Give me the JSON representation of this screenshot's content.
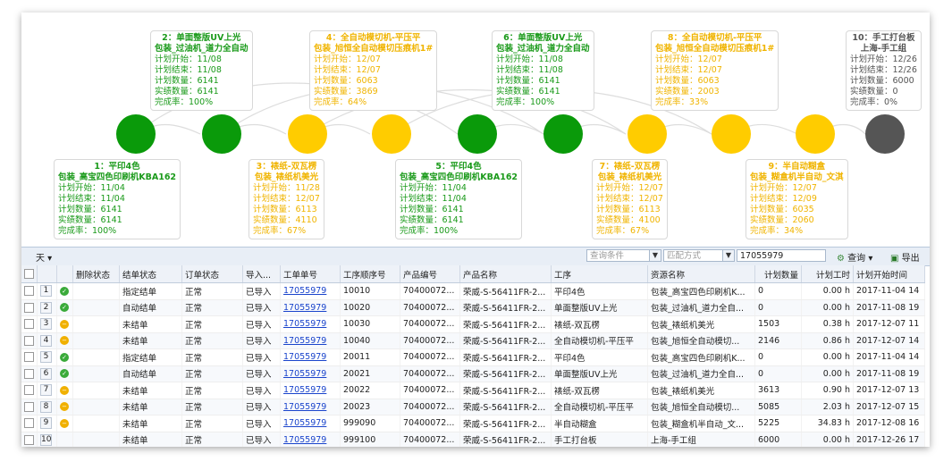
{
  "colors": {
    "green": "#0a9a0a",
    "yellow": "#ffcc00",
    "gray": "#555555"
  },
  "process_nodes": [
    {
      "id": 1,
      "status": "green",
      "title1": "1：平印4色",
      "title2": "包装_高宝四色印刷机KBA162",
      "plan_start": "计划开始：11/04",
      "plan_end": "计划结束：11/04",
      "plan_qty": "计划数量：6141",
      "actual_qty": "实绩数量：6141",
      "completion": "完成率：100%"
    },
    {
      "id": 2,
      "status": "green",
      "title1": "2：单面整版UV上光",
      "title2": "包装_过油机_道力全自动",
      "plan_start": "计划开始：11/08",
      "plan_end": "计划结束：11/08",
      "plan_qty": "计划数量：6141",
      "actual_qty": "实绩数量：6141",
      "completion": "完成率：100%"
    },
    {
      "id": 3,
      "status": "yellow",
      "title1": "3：裱纸-双瓦楞",
      "title2": "包装_裱纸机美光",
      "plan_start": "计划开始：11/28",
      "plan_end": "计划结束：12/07",
      "plan_qty": "计划数量：6113",
      "actual_qty": "实绩数量：4110",
      "completion": "完成率：67%"
    },
    {
      "id": 4,
      "status": "yellow",
      "title1": "4：全自动模切机-平压平",
      "title2": "包装_旭恒全自动模切压痕机1#",
      "plan_start": "计划开始：12/07",
      "plan_end": "计划结束：12/07",
      "plan_qty": "计划数量：6063",
      "actual_qty": "实绩数量：3869",
      "completion": "完成率：64%"
    },
    {
      "id": 5,
      "status": "green",
      "title1": "5：平印4色",
      "title2": "包装_高宝四色印刷机KBA162",
      "plan_start": "计划开始：11/04",
      "plan_end": "计划结束：11/04",
      "plan_qty": "计划数量：6141",
      "actual_qty": "实绩数量：6141",
      "completion": "完成率：100%"
    },
    {
      "id": 6,
      "status": "green",
      "title1": "6：单面整版UV上光",
      "title2": "包装_过油机_道力全自动",
      "plan_start": "计划开始：11/08",
      "plan_end": "计划结束：11/08",
      "plan_qty": "计划数量：6141",
      "actual_qty": "实绩数量：6141",
      "completion": "完成率：100%"
    },
    {
      "id": 7,
      "status": "yellow",
      "title1": "7：裱纸-双瓦楞",
      "title2": "包装_裱纸机美光",
      "plan_start": "计划开始：12/07",
      "plan_end": "计划结束：12/07",
      "plan_qty": "计划数量：6113",
      "actual_qty": "实绩数量：4100",
      "completion": "完成率：67%"
    },
    {
      "id": 8,
      "status": "yellow",
      "title1": "8：全自动模切机-平压平",
      "title2": "包装_旭恒全自动模切压痕机1#",
      "plan_start": "计划开始：12/07",
      "plan_end": "计划结束：12/07",
      "plan_qty": "计划数量：6063",
      "actual_qty": "实绩数量：2003",
      "completion": "完成率：33%"
    },
    {
      "id": 9,
      "status": "yellow",
      "title1": "9：半自动糊盒",
      "title2": "包装_糊盒机半自动_文淇",
      "plan_start": "计划开始：12/07",
      "plan_end": "计划结束：12/09",
      "plan_qty": "计划数量：6035",
      "actual_qty": "实绩数量：2060",
      "completion": "完成率：34%"
    },
    {
      "id": 10,
      "status": "gray",
      "title1": "10：手工打台板",
      "title2": "上海-手工组",
      "plan_start": "计划开始：12/26",
      "plan_end": "计划结束：12/26",
      "plan_qty": "计划数量：6000",
      "actual_qty": "实绩数量：0",
      "completion": "完成率：0%"
    }
  ],
  "toolbar": {
    "view_label": "天",
    "query_placeholder": "查询条件",
    "match_placeholder": "匹配方式",
    "search_value": "17055979",
    "search_label": "查询",
    "export_label": "导出"
  },
  "table": {
    "headers": [
      "删除状态",
      "结单状态",
      "订单状态",
      "导入...",
      "工单单号",
      "工序顺序号",
      "产品编号",
      "产品名称",
      "工序",
      "资源名称",
      "计划数量",
      "计划工时",
      "计划开始时间"
    ],
    "rows": [
      {
        "n": "1",
        "status": "ok",
        "close": "指定结单",
        "order": "正常",
        "imp": "已导入",
        "wo": "17055979",
        "seq": "10010",
        "pno": "70400072...",
        "pname": "荣威-S-56411FR-2...",
        "proc": "平印4色",
        "res": "包装_高宝四色印刷机K...",
        "qty": "0",
        "hours": "0.00 h",
        "start": "2017-11-04 14"
      },
      {
        "n": "2",
        "status": "ok",
        "close": "自动结单",
        "order": "正常",
        "imp": "已导入",
        "wo": "17055979",
        "seq": "10020",
        "pno": "70400072...",
        "pname": "荣威-S-56411FR-2...",
        "proc": "单面整版UV上光",
        "res": "包装_过油机_道力全自...",
        "qty": "0",
        "hours": "0.00 h",
        "start": "2017-11-08 19"
      },
      {
        "n": "3",
        "status": "warn",
        "close": "未结单",
        "order": "正常",
        "imp": "已导入",
        "wo": "17055979",
        "seq": "10030",
        "pno": "70400072...",
        "pname": "荣威-S-56411FR-2...",
        "proc": "裱纸-双瓦楞",
        "res": "包装_裱纸机美光",
        "qty": "1503",
        "hours": "0.38 h",
        "start": "2017-12-07 11"
      },
      {
        "n": "4",
        "status": "warn",
        "close": "未结单",
        "order": "正常",
        "imp": "已导入",
        "wo": "17055979",
        "seq": "10040",
        "pno": "70400072...",
        "pname": "荣威-S-56411FR-2...",
        "proc": "全自动模切机-平压平",
        "res": "包装_旭恒全自动模切...",
        "qty": "2146",
        "hours": "0.86 h",
        "start": "2017-12-07 14"
      },
      {
        "n": "5",
        "status": "ok",
        "close": "指定结单",
        "order": "正常",
        "imp": "已导入",
        "wo": "17055979",
        "seq": "20011",
        "pno": "70400072...",
        "pname": "荣威-S-56411FR-2...",
        "proc": "平印4色",
        "res": "包装_高宝四色印刷机K...",
        "qty": "0",
        "hours": "0.00 h",
        "start": "2017-11-04 14"
      },
      {
        "n": "6",
        "status": "ok",
        "close": "自动结单",
        "order": "正常",
        "imp": "已导入",
        "wo": "17055979",
        "seq": "20021",
        "pno": "70400072...",
        "pname": "荣威-S-56411FR-2...",
        "proc": "单面整版UV上光",
        "res": "包装_过油机_道力全自...",
        "qty": "0",
        "hours": "0.00 h",
        "start": "2017-11-08 19"
      },
      {
        "n": "7",
        "status": "warn",
        "close": "未结单",
        "order": "正常",
        "imp": "已导入",
        "wo": "17055979",
        "seq": "20022",
        "pno": "70400072...",
        "pname": "荣威-S-56411FR-2...",
        "proc": "裱纸-双瓦楞",
        "res": "包装_裱纸机美光",
        "qty": "3613",
        "hours": "0.90 h",
        "start": "2017-12-07 13"
      },
      {
        "n": "8",
        "status": "warn",
        "close": "未结单",
        "order": "正常",
        "imp": "已导入",
        "wo": "17055979",
        "seq": "20023",
        "pno": "70400072...",
        "pname": "荣威-S-56411FR-2...",
        "proc": "全自动模切机-平压平",
        "res": "包装_旭恒全自动模切...",
        "qty": "5085",
        "hours": "2.03 h",
        "start": "2017-12-07 15"
      },
      {
        "n": "9",
        "status": "warn",
        "close": "未结单",
        "order": "正常",
        "imp": "已导入",
        "wo": "17055979",
        "seq": "999090",
        "pno": "70400072...",
        "pname": "荣威-S-56411FR-2...",
        "proc": "半自动糊盒",
        "res": "包装_糊盒机半自动_文...",
        "qty": "5225",
        "hours": "34.83 h",
        "start": "2017-12-08 16"
      },
      {
        "n": "10",
        "status": "none",
        "close": "未结单",
        "order": "正常",
        "imp": "已导入",
        "wo": "17055979",
        "seq": "999100",
        "pno": "70400072...",
        "pname": "荣威-S-56411FR-2...",
        "proc": "手工打台板",
        "res": "上海-手工组",
        "qty": "6000",
        "hours": "0.00 h",
        "start": "2017-12-26 17"
      }
    ]
  }
}
